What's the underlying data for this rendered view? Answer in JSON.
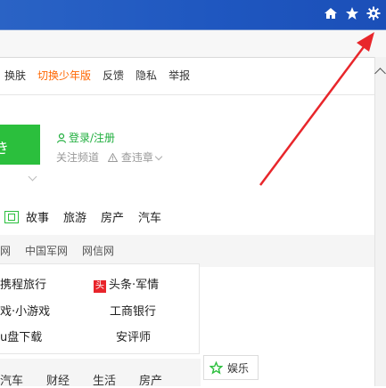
{
  "titlebar": {
    "icons": [
      "home-icon",
      "star-icon",
      "gear-icon"
    ]
  },
  "topnav": {
    "items": [
      "换肤",
      "切换少年版",
      "反馈",
      "隐私",
      "举报"
    ],
    "highlight_color": "#ff6600"
  },
  "login": {
    "green_box_char": "き",
    "link": "登录/注册",
    "follow": "关注频道",
    "query": "查违章"
  },
  "categories": [
    "故事",
    "旅游",
    "房产",
    "汽车"
  ],
  "sublinks": [
    "网",
    "中国军网",
    "网信网"
  ],
  "sites": {
    "ctrip": "携程旅行",
    "toutiao": "头条·军情",
    "toutiao_badge": "头",
    "games": "戏·小游戏",
    "icbc": "工商银行",
    "download": "u盘下载",
    "anping": "安评师"
  },
  "bottom": {
    "items": [
      "汽车",
      "财经",
      "生活",
      "房产"
    ],
    "entertainment": "娱乐"
  },
  "colors": {
    "titlebar": "#1f57c0",
    "green": "#2bbf3d",
    "arrow": "#e8262b"
  }
}
